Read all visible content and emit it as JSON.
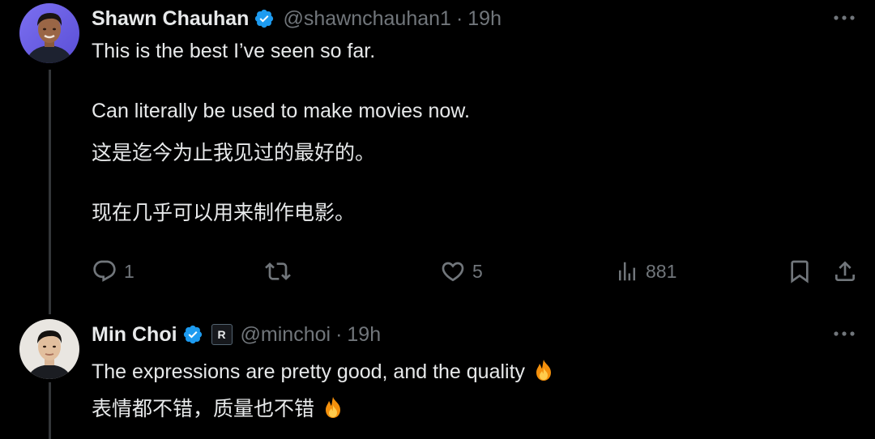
{
  "thread": [
    {
      "author": {
        "name": "Shawn Chauhan",
        "handle": "@shawnchauhan1",
        "verified": true
      },
      "separator": "·",
      "time": "19h",
      "text_lines": [
        "This is the best I’ve seen so far.",
        "Can literally be used to make movies now.",
        "这是迄今为止我见过的最好的。",
        "现在几乎可以用来制作电影。"
      ],
      "actions": {
        "replies": "1",
        "reposts": "",
        "likes": "5",
        "views": "881"
      }
    },
    {
      "author": {
        "name": "Min Choi",
        "handle": "@minchoi",
        "verified": true,
        "label_badge": "R"
      },
      "separator": "·",
      "time": "19h",
      "text_lines": [
        "The expressions are pretty good, and the quality",
        "表情都不错，质量也不错"
      ],
      "emoji": "fire"
    }
  ],
  "colors": {
    "background": "#000000",
    "text": "#e7e9ea",
    "muted": "#71767b",
    "verified_blue": "#1d9bf0",
    "thread_line": "#333639"
  },
  "icons": {
    "reply": "reply-icon",
    "repost": "repost-icon",
    "like": "heart-icon",
    "views": "views-icon",
    "bookmark": "bookmark-icon",
    "share": "share-icon",
    "more": "more-icon",
    "verified": "verified-badge-icon"
  }
}
